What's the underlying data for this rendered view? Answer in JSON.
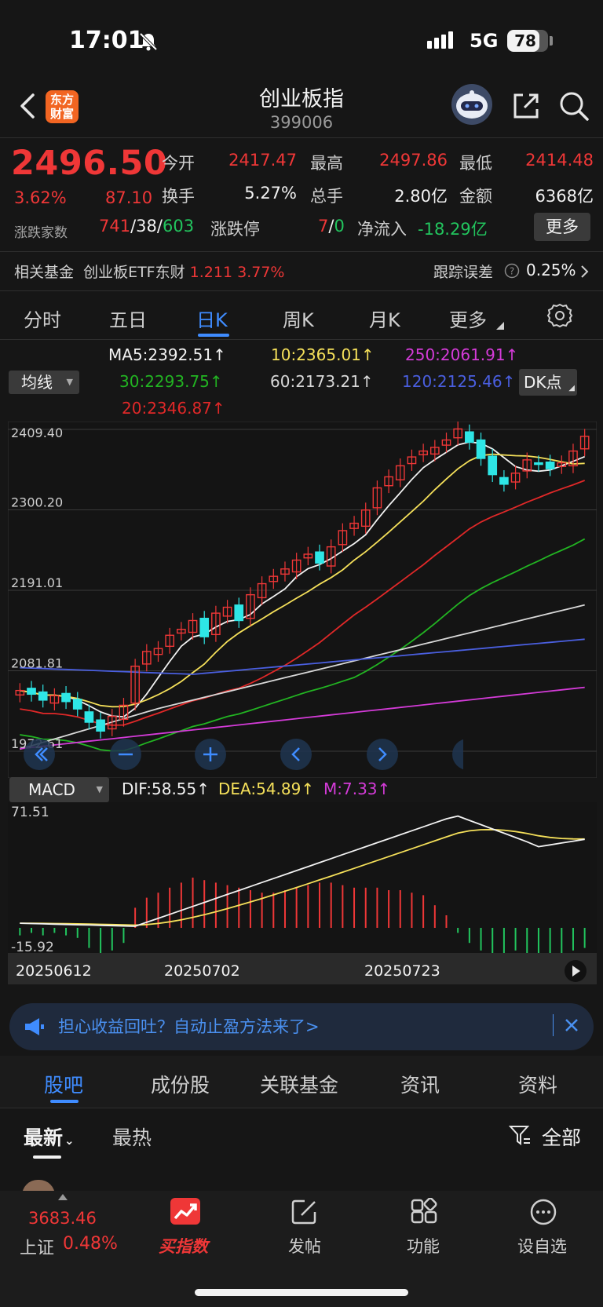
{
  "status": {
    "time": "17:01",
    "network": "5G",
    "battery": "78",
    "battery_level": 0.78
  },
  "header": {
    "logo_text_1": "东方",
    "logo_text_2": "财富",
    "title": "创业板指",
    "code": "399006"
  },
  "quote": {
    "price": "2496.50",
    "change_pct": "3.62%",
    "change": "87.10",
    "open_label": "今开",
    "open": "2417.47",
    "high_label": "最高",
    "high": "2497.86",
    "low_label": "最低",
    "low": "2414.48",
    "turnover_label": "换手",
    "turnover": "5.27%",
    "volume_label": "总手",
    "volume": "2.80亿",
    "amount_label": "金额",
    "amount": "6368亿",
    "breadth_label": "涨跌家数",
    "up": "741",
    "flat": "38",
    "down": "603",
    "limit_label": "涨跌停",
    "limit_up": "7",
    "limit_down": "0",
    "netflow_label": "净流入",
    "netflow": "-18.29亿",
    "more_label": "更多",
    "sep": "/"
  },
  "fund": {
    "label": "相关基金",
    "name": "创业板ETF东财",
    "price": "1.211",
    "pct": "3.77%",
    "track_label": "跟踪误差",
    "track_value": "0.25%"
  },
  "tabs": [
    "分时",
    "五日",
    "日K",
    "周K",
    "月K",
    "更多"
  ],
  "ma": {
    "selector": "均线",
    "ma5": "MA5:2392.51↑",
    "ma10": "10:2365.01↑",
    "ma250": "250:2061.91↑",
    "ma30": "30:2293.75↑",
    "ma60": "60:2173.21↑",
    "ma120": "120:2125.46↑",
    "ma20": "20:2346.87↑",
    "dk": "DK点"
  },
  "kline": {
    "y_labels": [
      "2409.40",
      "2300.20",
      "2191.01",
      "2081.81",
      "1972.61"
    ]
  },
  "macd": {
    "selector": "MACD",
    "dif": "DIF:58.55↑",
    "dea": "DEA:54.89↑",
    "m": "M:7.33↑",
    "y_top": "71.51",
    "y_bottom": "-15.92",
    "dates": [
      "20250612",
      "20250702",
      "20250723"
    ]
  },
  "chart_data": {
    "type": "candlestick",
    "indicators": [
      "MA5",
      "MA10",
      "MA20",
      "MA30",
      "MA60",
      "MA120",
      "MA250"
    ],
    "ylim": [
      1972.61,
      2409.4
    ],
    "grid": true
  },
  "ad": {
    "text": "担心收益回吐？自动止盈方法来了>"
  },
  "subtabs": [
    "股吧",
    "成份股",
    "关联基金",
    "资讯",
    "资料"
  ],
  "feed": {
    "sort_new": "最新",
    "sort_hot": "最热",
    "filter": "全部"
  },
  "bottom": {
    "index_value": "3683.46",
    "index_name": "上证",
    "index_pct": "0.48%",
    "nav": [
      "买指数",
      "发帖",
      "功能",
      "设自选"
    ]
  },
  "colors": {
    "up": "#ef3737",
    "down": "#22c55e",
    "accent": "#3f8cff",
    "teal": "#2ee6e6"
  }
}
